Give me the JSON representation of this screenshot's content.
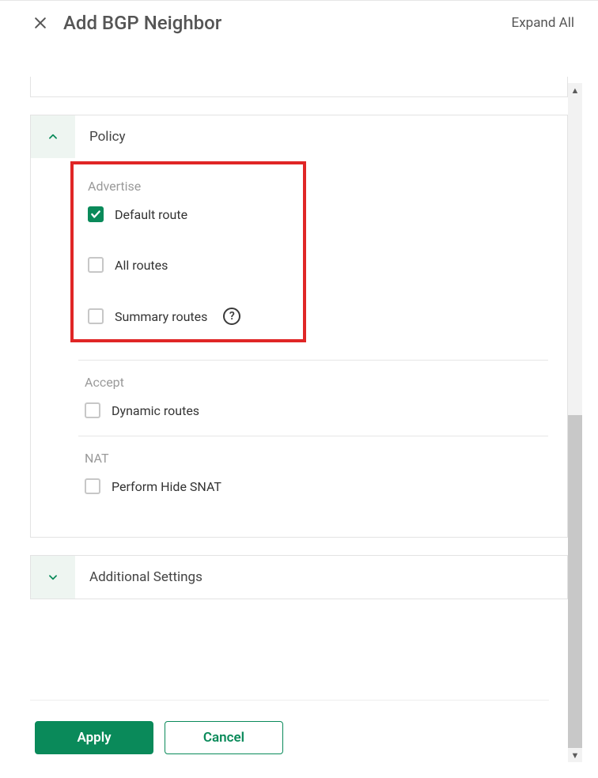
{
  "header": {
    "title": "Add BGP Neighbor",
    "expand_all": "Expand All"
  },
  "sections": {
    "policy": {
      "title": "Policy",
      "advertise": {
        "label": "Advertise",
        "options": {
          "default_route": {
            "label": "Default route",
            "checked": true
          },
          "all_routes": {
            "label": "All routes",
            "checked": false
          },
          "summary_routes": {
            "label": "Summary routes",
            "checked": false
          }
        }
      },
      "accept": {
        "label": "Accept",
        "options": {
          "dynamic_routes": {
            "label": "Dynamic routes",
            "checked": false
          }
        }
      },
      "nat": {
        "label": "NAT",
        "options": {
          "hide_snat": {
            "label": "Perform Hide SNAT",
            "checked": false
          }
        }
      }
    },
    "additional": {
      "title": "Additional Settings"
    }
  },
  "footer": {
    "apply": "Apply",
    "cancel": "Cancel"
  },
  "colors": {
    "accent": "#0a8a5a",
    "highlight_border": "#e02626"
  }
}
